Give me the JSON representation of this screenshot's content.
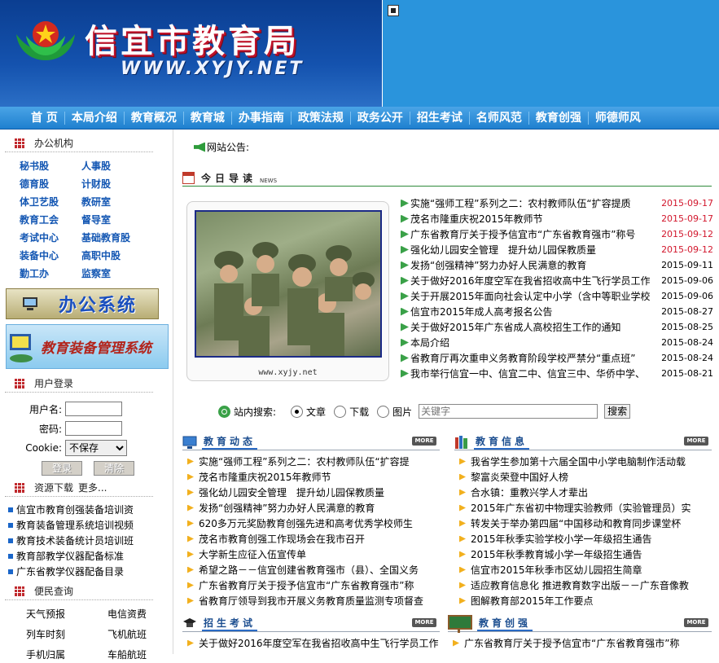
{
  "header": {
    "title": "信宜市教育局",
    "url": "WWW.XYJY.NET"
  },
  "nav": [
    "首 页",
    "本局介绍",
    "教育概况",
    "教育城",
    "办事指南",
    "政策法规",
    "政务公开",
    "招生考试",
    "名师风范",
    "教育创强",
    "师德师风"
  ],
  "office": {
    "title": "办公机构",
    "items": [
      "秘书股",
      "人事股",
      "德育股",
      "计财股",
      "体卫艺股",
      "教研室",
      "教育工会",
      "督导室",
      "考试中心",
      "基础教育股",
      "装备中心",
      "高职中股",
      "勤工办",
      "监察室"
    ]
  },
  "banners": {
    "office": "办公系统",
    "equip": "教育装备管理系统"
  },
  "login": {
    "title": "用户登录",
    "user_label": "用户名:",
    "pass_label": "密码:",
    "cookie_label": "Cookie:",
    "cookie_value": "不保存",
    "login_btn": "登录",
    "clear_btn": "清除"
  },
  "download": {
    "title": "资源下载",
    "more": "更多...",
    "items": [
      "信宜市教育创强装备培训资",
      "教育装备管理系统培训视频",
      "教育技术装备统计员培训班",
      "教育部教学仪器配备标准",
      "广东省教学仪器配备目录"
    ]
  },
  "service": {
    "title": "便民查询",
    "items": [
      "天气预报",
      "电信资费",
      "列车时刻",
      "飞机航班",
      "手机归属",
      "车船航班"
    ]
  },
  "notice": {
    "label": "网站公告:"
  },
  "today": {
    "title": "今日导读",
    "sub": "NEWS",
    "photo_caption": "www.xyjy.net"
  },
  "news": [
    {
      "title": "实施“强师工程”系列之二：农村教师队伍“扩容提质",
      "date": "2015-09-17",
      "hot": true
    },
    {
      "title": "茂名市隆重庆祝2015年教师节",
      "date": "2015-09-17",
      "hot": true
    },
    {
      "title": "广东省教育厅关于授予信宜市“广东省教育强市”称号",
      "date": "2015-09-12",
      "hot": true
    },
    {
      "title": "强化幼儿园安全管理　提升幼儿园保教质量",
      "date": "2015-09-12",
      "hot": true
    },
    {
      "title": "发扬“创强精神”努力办好人民满意的教育",
      "date": "2015-09-11",
      "hot": false
    },
    {
      "title": "关于做好2016年度空军在我省招收高中生飞行学员工作",
      "date": "2015-09-06",
      "hot": false
    },
    {
      "title": "关于开展2015年面向社会认定中小学（含中等职业学校",
      "date": "2015-09-06",
      "hot": false
    },
    {
      "title": "信宜市2015年成人高考报名公告",
      "date": "2015-08-27",
      "hot": false
    },
    {
      "title": "关于做好2015年广东省成人高校招生工作的通知",
      "date": "2015-08-25",
      "hot": false
    },
    {
      "title": "本局介绍",
      "date": "2015-08-24",
      "hot": false
    },
    {
      "title": "省教育厅再次重申义务教育阶段学校严禁分“重点班”",
      "date": "2015-08-24",
      "hot": false
    },
    {
      "title": "我市举行信宜一中、信宜二中、信宜三中、华侨中学、",
      "date": "2015-08-21",
      "hot": false
    }
  ],
  "search": {
    "label": "站内搜索:",
    "opt_text": "文章",
    "opt_download": "下载",
    "opt_image": "图片",
    "placeholder": "关键字",
    "button": "搜索"
  },
  "dynamics": {
    "title": "教育动态",
    "more": "MORE",
    "items": [
      "实施“强师工程”系列之二：农村教师队伍“扩容提",
      "茂名市隆重庆祝2015年教师节",
      "强化幼儿园安全管理　提升幼儿园保教质量",
      "发扬“创强精神”努力办好人民满意的教育",
      "620多万元奖励教育创强先进和高考优秀学校师生",
      "茂名市教育创强工作现场会在我市召开",
      "大学新生应征入伍宣传单",
      "希望之路－－信宜创建省教育强市（县）、全国义务",
      "广东省教育厅关于授予信宜市“广东省教育强市”称",
      "省教育厅领导到我市开展义务教育质量监测专项督查"
    ]
  },
  "info": {
    "title": "教育信息",
    "more": "MORE",
    "items": [
      "我省学生参加第十六届全国中小学电脑制作活动载",
      "黎富炎荣登中国好人榜",
      "合水镇：重教兴学人才辈出",
      "2015年广东省初中物理实验教师（实验管理员）实",
      "转发关于举办第四届“中国移动和教育同步课堂杯",
      "2015年秋季实验学校小学一年级招生通告",
      "2015年秋季教育城小学一年级招生通告",
      "信宜市2015年秋季市区幼儿园招生简章",
      "适应教育信息化 推进教育数字出版－－广东音像教",
      "图解教育部2015年工作要点"
    ]
  },
  "exam": {
    "title": "招生考试",
    "more": "MORE",
    "items": [
      "关于做好2016年度空军在我省招收高中生飞行学员工作"
    ]
  },
  "create": {
    "title": "教育创强",
    "more": "MORE",
    "items": [
      "广东省教育厅关于授予信宜市“广东省教育强市”称"
    ]
  }
}
